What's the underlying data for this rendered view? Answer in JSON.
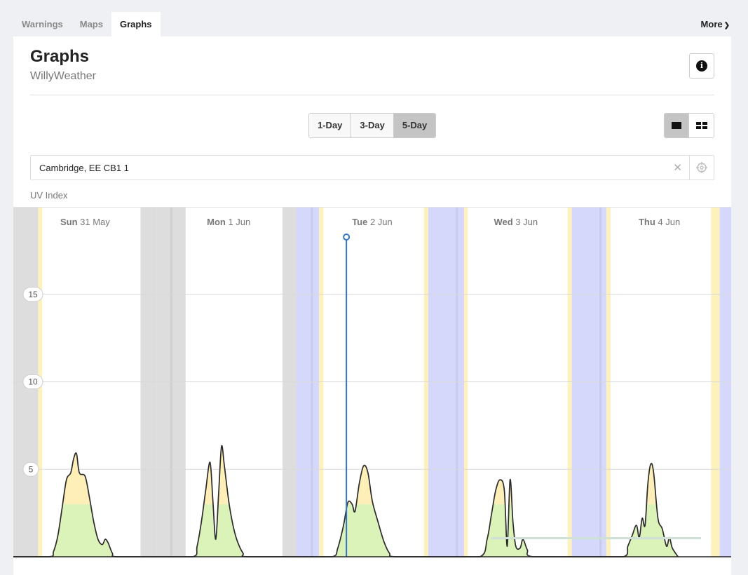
{
  "tabs": [
    {
      "label": "Warnings"
    },
    {
      "label": "Maps"
    },
    {
      "label": "Graphs",
      "active": true
    }
  ],
  "more_label": "More",
  "header": {
    "title": "Graphs",
    "subtitle": "WillyWeather",
    "info_icon": "info-icon"
  },
  "range": {
    "options": [
      "1-Day",
      "3-Day",
      "5-Day"
    ],
    "selected": "5-Day"
  },
  "view_toggle": {
    "options": [
      "single-view-icon",
      "grid-view-icon"
    ],
    "selected": "single-view-icon"
  },
  "location": {
    "value": "Cambridge, EE CB1 1",
    "clear_icon": "clear-icon",
    "gps_icon": "crosshair-icon"
  },
  "graph_label": "UV Index",
  "colors": {
    "low": "#dbf2b9",
    "moderate": "#fdefb7",
    "night": "#dddddd",
    "rain": "#d6d8fb",
    "twilight": "#fdf1bd",
    "cursor": "#3375c8"
  },
  "chart_data": {
    "type": "area",
    "title": "UV Index",
    "ylim": [
      0,
      20
    ],
    "yticks": [
      5,
      10,
      15
    ],
    "days": [
      {
        "weekday": "Sun",
        "date": "31 May"
      },
      {
        "weekday": "Mon",
        "date": "1 Jun"
      },
      {
        "weekday": "Tue",
        "date": "2 Jun"
      },
      {
        "weekday": "Wed",
        "date": "3 Jun"
      },
      {
        "weekday": "Thu",
        "date": "4 Jun"
      }
    ],
    "moderate_threshold": 3,
    "series": [
      {
        "values": [
          [
            0,
            0
          ],
          [
            0.25,
            0
          ],
          [
            0.28,
            0.3
          ],
          [
            0.31,
            1.2
          ],
          [
            0.34,
            2.8
          ],
          [
            0.37,
            4.4
          ],
          [
            0.4,
            4.8
          ],
          [
            0.42,
            5.6
          ],
          [
            0.44,
            5.9
          ],
          [
            0.46,
            4.8
          ],
          [
            0.5,
            4.6
          ],
          [
            0.53,
            3.4
          ],
          [
            0.56,
            2.0
          ],
          [
            0.59,
            1.0
          ],
          [
            0.62,
            0.7
          ],
          [
            0.64,
            1.0
          ],
          [
            0.66,
            0.8
          ],
          [
            0.69,
            0.2
          ],
          [
            0.72,
            0
          ],
          [
            1.0,
            0
          ],
          [
            1.25,
            0
          ],
          [
            1.28,
            0.6
          ],
          [
            1.31,
            2.0
          ],
          [
            1.34,
            3.8
          ],
          [
            1.37,
            5.4
          ],
          [
            1.39,
            3.2
          ],
          [
            1.41,
            1.0
          ],
          [
            1.43,
            3.6
          ],
          [
            1.45,
            6.3
          ],
          [
            1.47,
            5.2
          ],
          [
            1.5,
            3.2
          ],
          [
            1.53,
            1.8
          ],
          [
            1.56,
            0.9
          ],
          [
            1.6,
            0.2
          ],
          [
            1.63,
            0
          ],
          [
            2.0,
            0
          ],
          [
            2.22,
            0
          ],
          [
            2.26,
            0.5
          ],
          [
            2.3,
            1.8
          ],
          [
            2.33,
            3.1
          ],
          [
            2.36,
            3.0
          ],
          [
            2.38,
            2.6
          ],
          [
            2.41,
            4.2
          ],
          [
            2.44,
            5.2
          ],
          [
            2.47,
            4.8
          ],
          [
            2.5,
            3.2
          ],
          [
            2.54,
            2.0
          ],
          [
            2.58,
            0.9
          ],
          [
            2.62,
            0.2
          ],
          [
            2.66,
            0
          ],
          [
            3.0,
            0
          ],
          [
            3.25,
            0
          ],
          [
            3.3,
            1.0
          ],
          [
            3.33,
            2.4
          ],
          [
            3.36,
            3.8
          ],
          [
            3.39,
            4.4
          ],
          [
            3.42,
            3.8
          ],
          [
            3.44,
            0.6
          ],
          [
            3.46,
            4.4
          ],
          [
            3.48,
            2.0
          ],
          [
            3.5,
            0.6
          ],
          [
            3.53,
            0.5
          ],
          [
            3.55,
            1.0
          ],
          [
            3.58,
            0.4
          ],
          [
            3.62,
            0
          ],
          [
            4.0,
            0
          ],
          [
            4.25,
            0
          ],
          [
            4.28,
            0.6
          ],
          [
            4.31,
            1.2
          ],
          [
            4.34,
            1.8
          ],
          [
            4.36,
            1.1
          ],
          [
            4.38,
            2.2
          ],
          [
            4.4,
            1.8
          ],
          [
            4.42,
            4.2
          ],
          [
            4.44,
            5.3
          ],
          [
            4.46,
            4.8
          ],
          [
            4.49,
            2.2
          ],
          [
            4.52,
            1.6
          ],
          [
            4.55,
            0.6
          ],
          [
            4.57,
            1.1
          ],
          [
            4.59,
            0.5
          ],
          [
            4.63,
            0
          ]
        ]
      }
    ],
    "bands": [
      {
        "kind": "night",
        "from": 0.0,
        "to": 0.173
      },
      {
        "kind": "twilight",
        "from": 0.173,
        "to": 0.2
      },
      {
        "kind": "night",
        "from": 0.886,
        "to": 1.0
      },
      {
        "kind": "night",
        "from": 1.0,
        "to": 1.2
      },
      {
        "kind": "night",
        "from": 1.875,
        "to": 1.97
      },
      {
        "kind": "rain",
        "from": 1.97,
        "to": 2.13
      },
      {
        "kind": "twilight",
        "from": 2.13,
        "to": 2.16
      },
      {
        "kind": "twilight",
        "from": 2.86,
        "to": 2.89
      },
      {
        "kind": "rain",
        "from": 2.89,
        "to": 3.14
      },
      {
        "kind": "twilight",
        "from": 3.14,
        "to": 3.165
      },
      {
        "kind": "twilight",
        "from": 3.86,
        "to": 3.89
      },
      {
        "kind": "rain",
        "from": 3.89,
        "to": 4.13
      },
      {
        "kind": "twilight",
        "from": 4.13,
        "to": 4.16
      },
      {
        "kind": "twilight",
        "from": 4.86,
        "to": 4.92
      },
      {
        "kind": "rain",
        "from": 4.92,
        "to": 5.0
      }
    ],
    "cursor_x": 2.32
  }
}
